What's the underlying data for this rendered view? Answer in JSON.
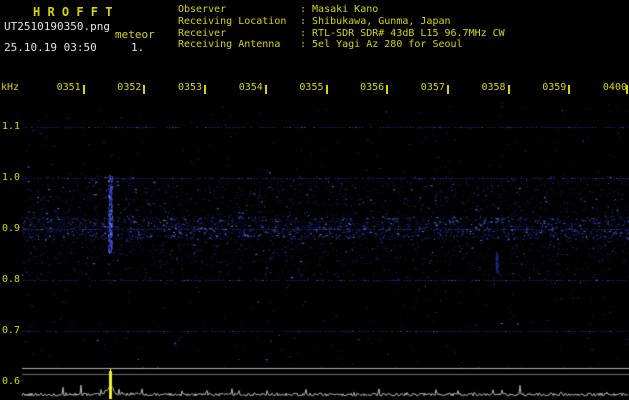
{
  "colors": {
    "background": "#000000",
    "accent_yellow": "#d6d600",
    "text_white": "#e2e2e2",
    "grid_blue": "#1d1d62",
    "noise_blue": "#3040c8",
    "trace_gray": "#b4b4b4",
    "ref_line_light": "#b0b0b0",
    "ref_line_dim": "#6e6e6e",
    "spike_yellow": "#e8e800"
  },
  "header": {
    "title": "H R O F F T",
    "filename": "UT2510190350.png",
    "mode": "meteor",
    "datetime": "25.10.19 03:50",
    "counter": "1.",
    "info": [
      {
        "label": "Observer",
        "value": ": Masaki Kano"
      },
      {
        "label": "Receiving Location",
        "value": ": Shibukawa, Gunma, Japan"
      },
      {
        "label": "Receiver",
        "value": ": RTL-SDR SDR# 43dB L15 96.7MHz CW"
      },
      {
        "label": "Receiving Antenna",
        "value": ": 5el Yagi Az 280 for Seoul"
      }
    ]
  },
  "chart_data": {
    "type": "heatmap",
    "x_axis": {
      "ticks": [
        "0351",
        "0352",
        "0353",
        "0354",
        "0355",
        "0356",
        "0357",
        "0358",
        "0359",
        "0400"
      ],
      "range": [
        "0350",
        "0400"
      ]
    },
    "y_axis": {
      "label": "kHz",
      "ticks": [
        "1.1",
        "1.0",
        "0.9",
        "0.8",
        "0.7",
        "0.6"
      ],
      "range_khz": [
        0.6,
        1.16
      ]
    },
    "grid": "faint dotted horizontal blue lines at each 0.1 kHz",
    "noise_bands": [
      {
        "f_low": 0.88,
        "f_high": 0.925,
        "dots": 2600,
        "bright": 0.16
      },
      {
        "f_low": 0.925,
        "f_high": 1.005,
        "dots": 1100,
        "bright": 0.08
      },
      {
        "f_low": 0.83,
        "f_high": 0.88,
        "dots": 650,
        "bright": 0.06
      },
      {
        "f_low": 0.795,
        "f_high": 0.825,
        "dots": 220,
        "bright": 0.05
      },
      {
        "f_low": 0.62,
        "f_high": 1.15,
        "dots": 800,
        "bright": 0.03
      }
    ],
    "events": [
      {
        "name": "meteor-echo",
        "time_utc": "0351:27",
        "time_frac": 0.145,
        "f_low": 0.855,
        "f_high": 1.005,
        "intensity": "strong",
        "power_spike": true
      },
      {
        "name": "weak-echo",
        "time_utc": "0357:49",
        "time_frac": 0.782,
        "f_low": 0.815,
        "f_high": 0.855,
        "intensity": "faint",
        "power_spike": false
      }
    ],
    "power_trace": {
      "description": "noise-level graph along bottom strip",
      "baseline_frac": 0.99,
      "spike_count": 1
    }
  }
}
